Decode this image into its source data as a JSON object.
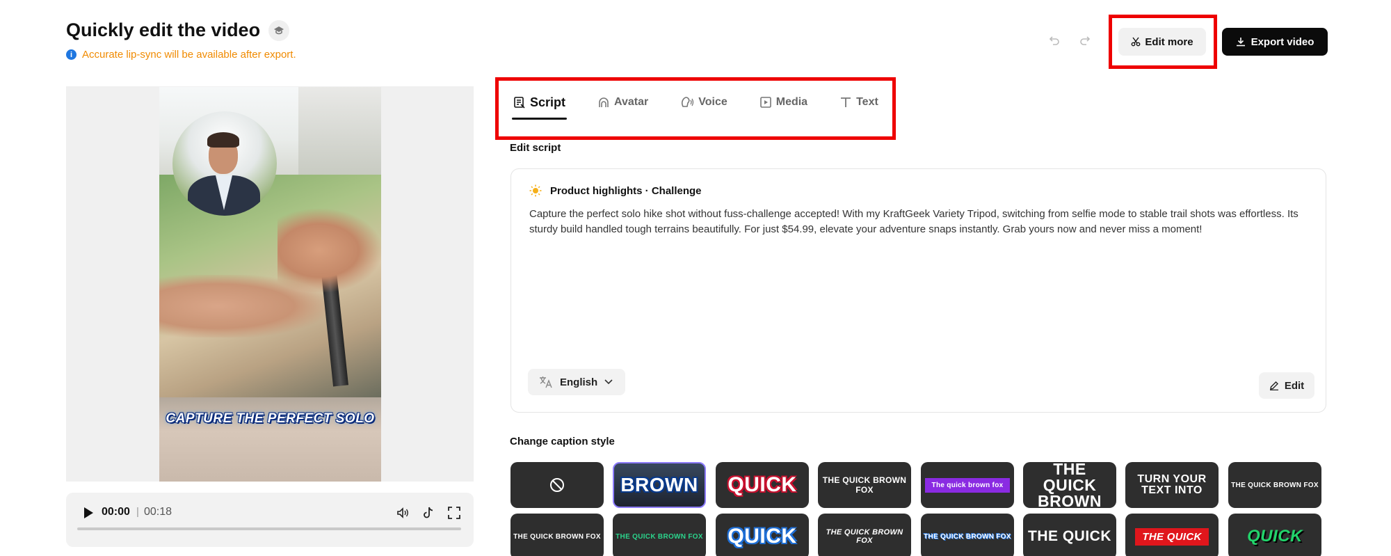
{
  "header": {
    "title": "Quickly edit the video",
    "notice": "Accurate lip-sync will be available after export.",
    "edit_more_label": "Edit more",
    "export_label": "Export video"
  },
  "preview": {
    "caption_text": "CAPTURE THE PERFECT SOLO",
    "time_current": "00:00",
    "time_separator": "|",
    "time_total": "00:18"
  },
  "tabs": [
    {
      "label": "Script",
      "icon": "script-icon",
      "active": true
    },
    {
      "label": "Avatar",
      "icon": "avatar-icon",
      "active": false
    },
    {
      "label": "Voice",
      "icon": "voice-icon",
      "active": false
    },
    {
      "label": "Media",
      "icon": "media-icon",
      "active": false
    },
    {
      "label": "Text",
      "icon": "text-icon",
      "active": false
    }
  ],
  "script": {
    "section_label": "Edit script",
    "heading": "Product highlights · Challenge",
    "body": "Capture the perfect solo hike shot without fuss-challenge accepted! With my KraftGeek Variety Tripod, switching from selfie mode to stable trail shots was effortless. Its sturdy build handled tough terrains beautifully. For just $54.99, elevate your adventure snaps instantly. Grab yours now and never miss a moment!",
    "language": "English",
    "edit_label": "Edit"
  },
  "caption_styles": {
    "section_label": "Change caption style",
    "row1": [
      "",
      "BROWN",
      "QUICK",
      "THE QUICK BROWN FOX",
      "The quick brown fox",
      "THE QUICK BROWN",
      "TURN YOUR TEXT INTO",
      "THE QUICK BROWN FOX"
    ],
    "row2": [
      "THE QUICK BROWN FOX",
      "THE QUICK BROWN FOX",
      "QUICK",
      "THE QUICK BROWN FOX",
      "THE QUICK BROWN FOX",
      "THE QUICK",
      "THE QUICK",
      "QUICK"
    ]
  },
  "colors": {
    "highlight": "#ee0000",
    "notice": "#f08a00",
    "info": "#1f77e0",
    "export_bg": "#0b0b0b"
  }
}
